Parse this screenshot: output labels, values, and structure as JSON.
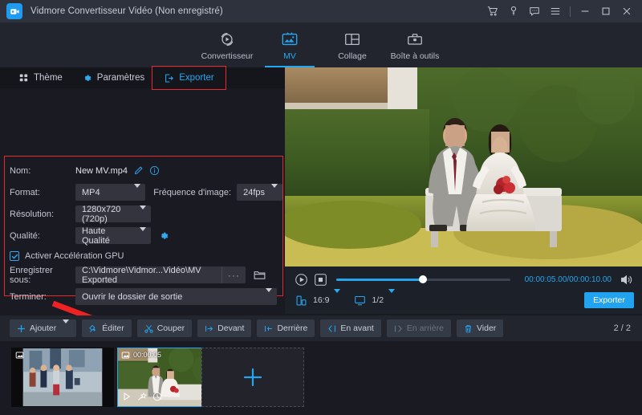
{
  "window": {
    "title": "Vidmore Convertisseur Vidéo (Non enregistré)",
    "logo_icon": "app-logo-icon",
    "controls": [
      {
        "name": "cart-icon",
        "glyph": "cart"
      },
      {
        "name": "key-icon",
        "glyph": "key"
      },
      {
        "name": "feedback-icon",
        "glyph": "message"
      },
      {
        "name": "menu-icon",
        "glyph": "hamburger"
      },
      {
        "name": "minimize-icon",
        "glyph": "minimize"
      },
      {
        "name": "maximize-icon",
        "glyph": "maximize"
      },
      {
        "name": "close-icon",
        "glyph": "close"
      }
    ]
  },
  "mainnav": {
    "items": [
      {
        "label": "Convertisseur",
        "icon": "converter-icon",
        "active": false
      },
      {
        "label": "MV",
        "icon": "mv-icon",
        "active": true
      },
      {
        "label": "Collage",
        "icon": "collage-icon",
        "active": false
      },
      {
        "label": "Boîte à outils",
        "icon": "toolbox-icon",
        "active": false
      }
    ]
  },
  "subtabs": {
    "theme": "Thème",
    "settings": "Paramètres",
    "export": "Exporter"
  },
  "form": {
    "name_label": "Nom:",
    "name_value": "New MV.mp4",
    "format_label": "Format:",
    "format_value": "MP4",
    "framerate_label": "Fréquence d'image:",
    "framerate_value": "24fps",
    "resolution_label": "Résolution:",
    "resolution_value": "1280x720 (720p)",
    "quality_label": "Qualité:",
    "quality_value": "Haute Qualité",
    "gpu_label": "Activer Accélération GPU",
    "gpu_checked": true,
    "saveto_label": "Enregistrer sous:",
    "saveto_value": "C:\\Vidmore\\Vidmor...Vidéo\\MV Exported",
    "browse_dots": "···",
    "finish_label": "Terminer:",
    "finish_value": "Ouvrir le dossier de sortie",
    "export_button": "Exporter"
  },
  "player": {
    "play_icon": "play-icon",
    "stop_icon": "stop-icon",
    "time": "00:00:05.00/00:00:10.00",
    "volume_icon": "volume-icon",
    "progress_percent": 50,
    "aspect_icon": "aspect-ratio-icon",
    "aspect_value": "16:9",
    "screen_icon": "screen-icon",
    "screen_value": "1/2",
    "export_button": "Exporter"
  },
  "toolbar": {
    "buttons": [
      {
        "label": "Ajouter",
        "icon": "plus-icon",
        "dropdown": true,
        "disabled": false
      },
      {
        "label": "Éditer",
        "icon": "edit-pin-icon",
        "dropdown": false,
        "disabled": false
      },
      {
        "label": "Couper",
        "icon": "scissors-icon",
        "dropdown": false,
        "disabled": false
      },
      {
        "label": "Devant",
        "icon": "move-front-icon",
        "dropdown": false,
        "disabled": false
      },
      {
        "label": "Derrière",
        "icon": "move-back-icon",
        "dropdown": false,
        "disabled": false
      },
      {
        "label": "En avant",
        "icon": "forward-icon",
        "dropdown": false,
        "disabled": false
      },
      {
        "label": "En arrière",
        "icon": "backward-icon",
        "dropdown": false,
        "disabled": true
      },
      {
        "label": "Vider",
        "icon": "trash-icon",
        "dropdown": false,
        "disabled": false
      }
    ],
    "page_count": "2 / 2"
  },
  "timeline": {
    "clips": [
      {
        "name": "clip-1",
        "selected": false,
        "time": ""
      },
      {
        "name": "clip-2",
        "selected": true,
        "time": "00:00:05"
      }
    ],
    "add_icon": "plus-icon",
    "clip_icons": [
      "play-icon",
      "magic-wand-icon",
      "clock-icon"
    ],
    "close_icon": "close-icon",
    "image_icon": "image-icon"
  },
  "colors": {
    "accent": "#21a3ef",
    "highlight": "#e8282b",
    "panel": "#1a1a23",
    "titlebar": "#2e323d",
    "nav": "#22252e",
    "control": "#34343f"
  }
}
